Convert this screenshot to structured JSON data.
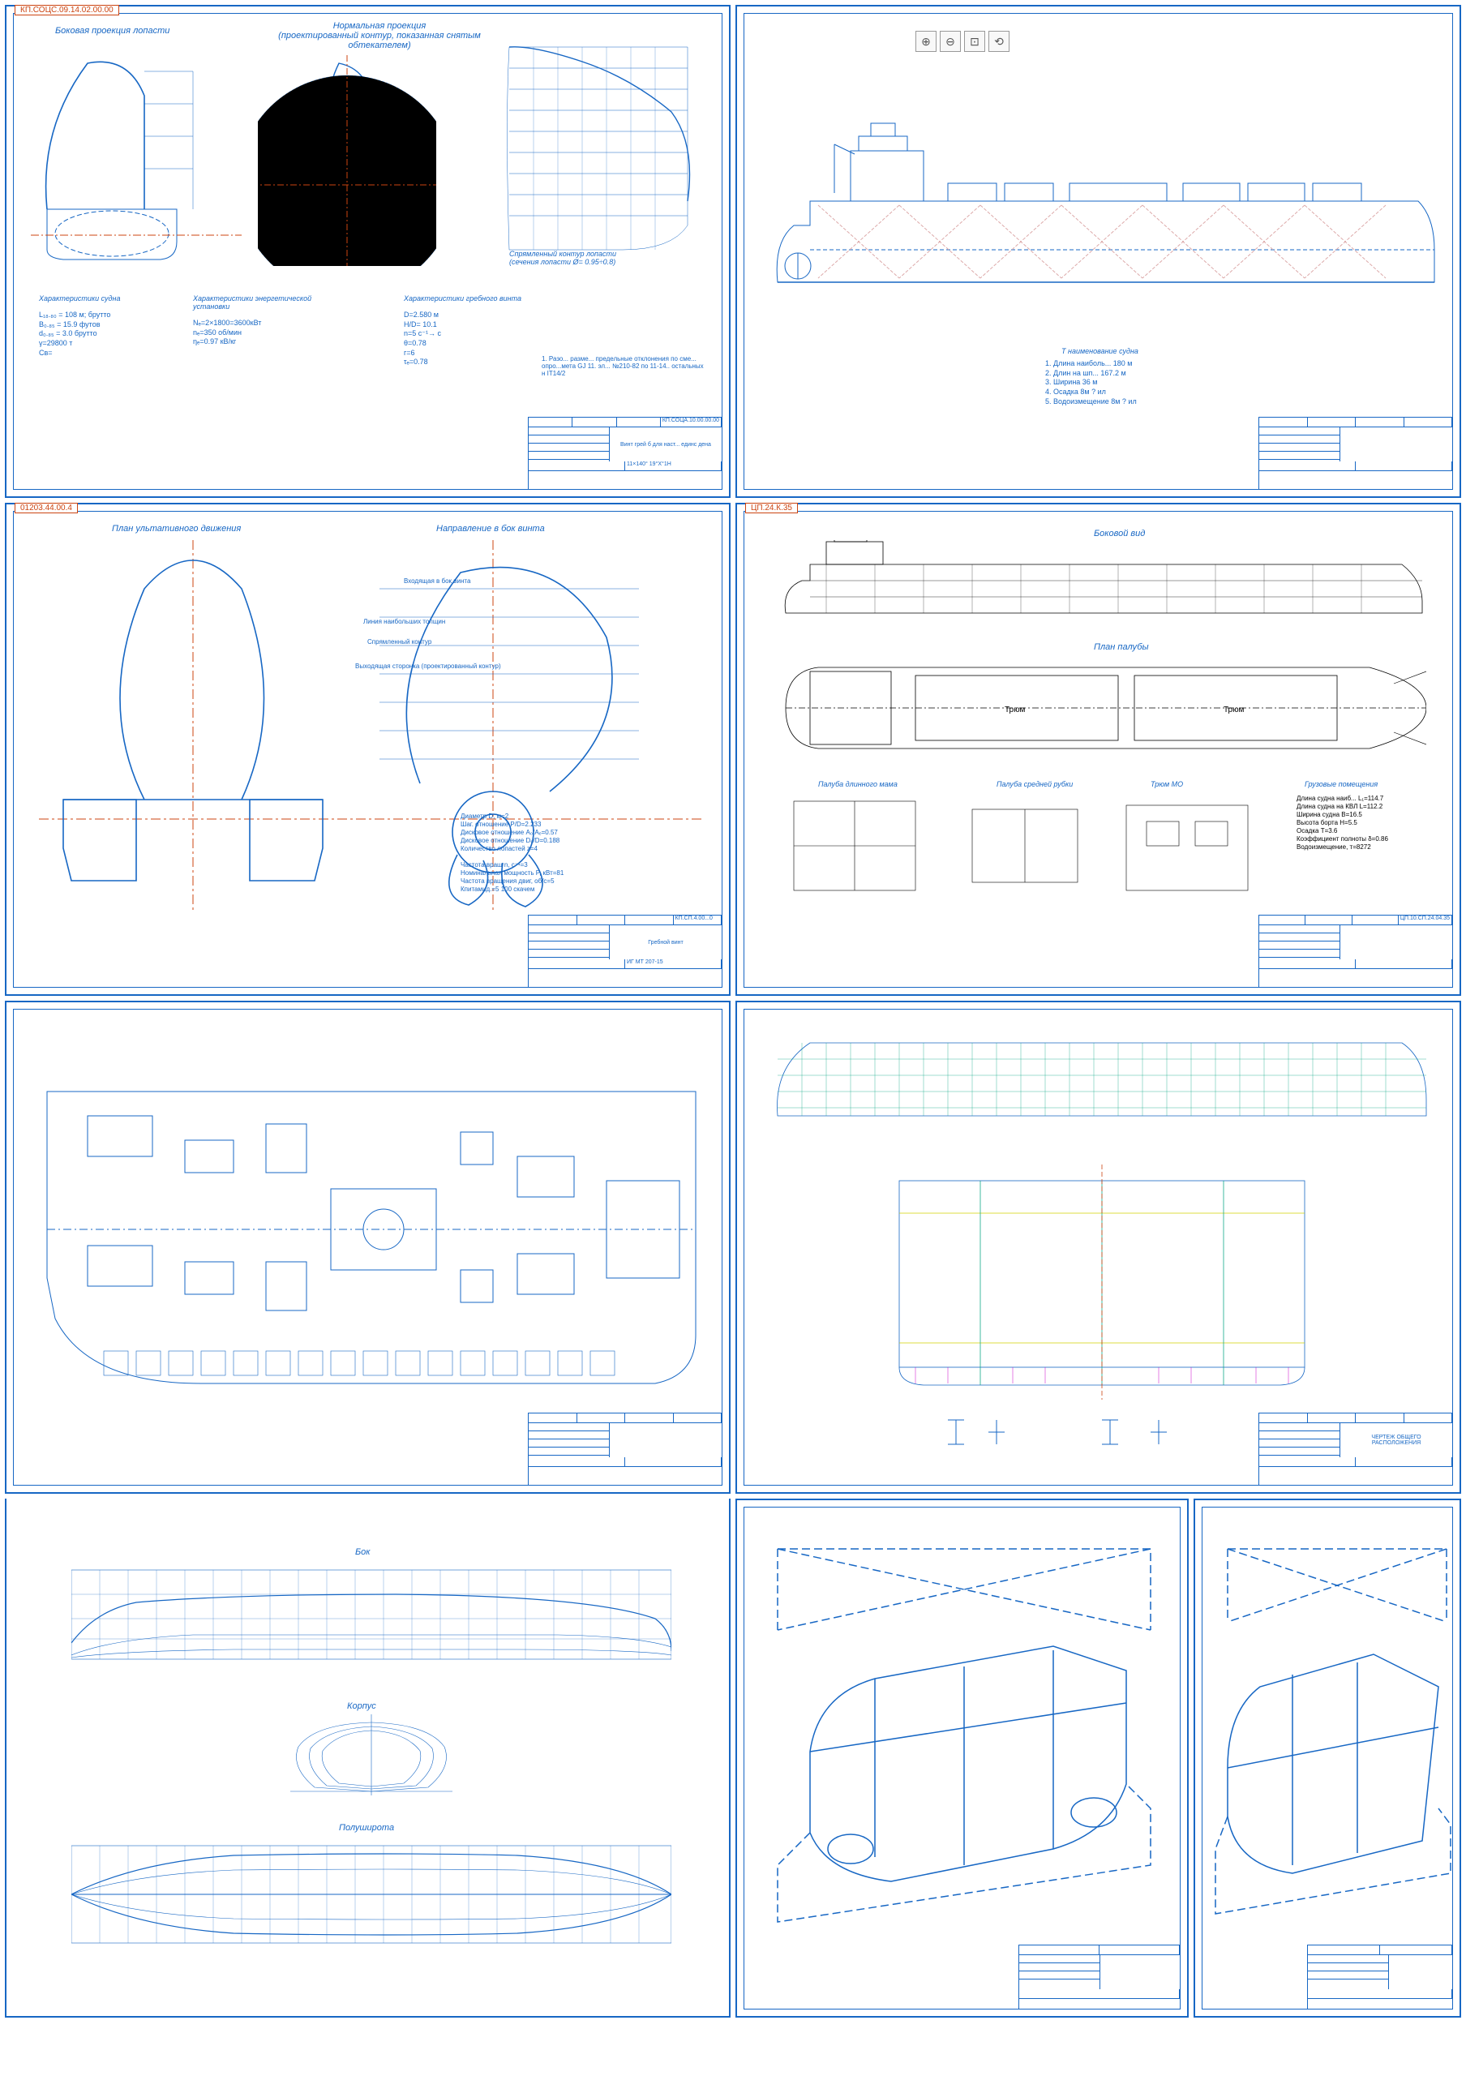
{
  "sheets": {
    "s1": {
      "tag": "КП.СОЦС.09.14.02.00.00",
      "title_left": "Боковая проекция лопасти",
      "title_center": "Нормальная проекция\n(проектированный контур, показанная снятым обтекателем)",
      "subtitle": "Спрямленный контур лопасти\n(сечения лопасти Ø= 0.95÷0.8)",
      "char_ship_h": "Характеристики судна",
      "char_ship": [
        "L₁₈.₈₀ = 108 м; брутто",
        "B₀.₈₅ = 15.9 футов",
        "d₀.₈₅ = 3.0 брутто",
        "γ=29800 т",
        "Cв="
      ],
      "char_power_h": "Характеристики энергетической установки",
      "char_power": [
        "Nₑ=2×1800=3600кВт",
        "nₑ=350 об/мин",
        "ηₑ=0.97 кВ/кг"
      ],
      "char_prop_h": "Характеристики гребного винта",
      "char_prop": [
        "D=2.580 м",
        "H/D= 10.1",
        "n=5 с⁻¹→ с",
        "θ=0.78",
        "г=6",
        "τₑ=0.78"
      ],
      "note": "1. Разо... разме... предельные отклонения по сме...\nопро...мета GJ 11. эл... №210-82 по 11-14.. остальных\nн IT14/2",
      "tb_code": "КП.СОЦА.10.00.00.00",
      "tb_name": "Винт грей б\nдля наст... единс дена",
      "tb_bottom": "11×140° 19°X°1H"
    },
    "s2": {
      "tb_code": "",
      "tb_name": "",
      "note_h": "Т наименование судна",
      "note": [
        "1. Длина наиболь...  180 м",
        "2. Длин на шп...  167.2 м",
        "3. Ширина  36 м",
        "4. Осадка  8м ? ил",
        "5. Водоизмещение  8м ? ил"
      ]
    },
    "s3": {
      "tag": "01203.44.00.4",
      "title_left": "План ультативного движения",
      "title_right": "Направление в бок винта",
      "labels": [
        "Линия наибольших толщин",
        "Спрямленный контур",
        "Выходящая сторонка (проектированный контур)",
        "Входящая в бок винта"
      ],
      "specs": [
        "Диаметр D, м=2",
        "Шаг. отношение P/D=2.233",
        "Дисковое отношение A₀/Aₑ=0.57",
        "Дисковое отношение D₀/D=0.188",
        "Количество лопастей z=4",
        "",
        "Частота вращ n, с⁻¹=3",
        "Номинальная мощность P, кВт=81",
        "Частота вращения двиг, об/с=5",
        "Кпитамид.=5 100 скачем"
      ],
      "tb_code": "КП.СП.4.00...0",
      "tb_name": "Гребной винт",
      "tb_bottom": "ИГ МТ 207-15"
    },
    "s4": {
      "tag": "ЦП.24.К.35",
      "view_top": "Боковой вид",
      "view_mid": "План палубы",
      "sec1": "Палуба длинного мама",
      "sec2": "Палуба средней рубки",
      "sec3": "Трюм МО",
      "sec4_h": "Грузовые помещения",
      "sec4": [
        "Длина судна наиб... L₁=114.7",
        "Длина судна на КВЛ L=112.2",
        "Ширина судна B=16.5",
        "Высота борта H=5.5",
        "Осадка Т=3.6",
        "Коэффициент полноты δ=0.86",
        "Водоизмещение, т=8272"
      ],
      "deck_labels": [
        "Трюм",
        "Трюм"
      ],
      "tb_code": "ЦП.10.СП.24.04.35",
      "tb_name": ""
    },
    "s5": {
      "tb_code": "",
      "tb_name": ""
    },
    "s6": {
      "tb_name": "ЧЕРТЕЖ ОБЩЕГО\nРАСПОЛОЖЕНИЯ"
    },
    "s7": {
      "title_top": "Бок",
      "title_mid": "Корпус",
      "title_bot": "Полуширота"
    },
    "s8": {
      "tb_name": ""
    },
    "s9": {
      "tb_name": ""
    }
  },
  "toolbar": {
    "zoom_in": "⊕",
    "zoom_out": "⊖",
    "zoom_fit": "⊡",
    "zoom_reset": "⟲"
  }
}
